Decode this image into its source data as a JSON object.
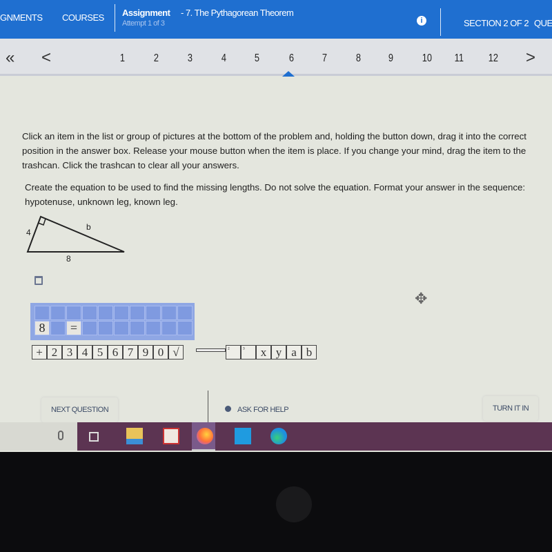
{
  "header": {
    "nav_assignments": "GNMENTS",
    "nav_courses": "COURSES",
    "assignment_label": "Assignment",
    "assignment_title": "- 7. The Pythagorean Theorem",
    "attempt": "Attempt 1 of 3",
    "info_icon": "info-icon",
    "section": "SECTION 2 OF 2",
    "questions_cut": "QUES",
    "color": "#1f6fd0"
  },
  "pager": {
    "first": "«",
    "prev": "<",
    "next": ">",
    "pages": [
      "1",
      "2",
      "3",
      "4",
      "5",
      "6",
      "7",
      "8",
      "9",
      "10",
      "11",
      "12"
    ],
    "current": "6"
  },
  "instructions": {
    "drag": "Click an item in the list or group of pictures at the bottom of the problem and, holding the button down, drag it into the correct position in the answer box. Release your mouse button when the item is place. If you change your mind, drag the item to the trashcan. Click the trashcan to clear all your answers.",
    "question": "Create the equation to be used to find the missing lengths. Do not solve the equation. Format your answer in the sequence: hypotenuse, unknown leg, known leg."
  },
  "figure": {
    "leg_label": "4",
    "hyp_label": "b",
    "base_label": "8"
  },
  "answer_box": {
    "cells": [
      "8",
      "",
      "="
    ]
  },
  "tiles": [
    "+",
    "2",
    "3",
    "4",
    "5",
    "6",
    "7",
    "9",
    "0",
    "√",
    "",
    "²",
    "³",
    "x",
    "y",
    "a",
    "b"
  ],
  "footer": {
    "next": "NEXT QUESTION",
    "help": "ASK FOR HELP",
    "turn_in": "TURN IT IN"
  },
  "taskbar": {
    "icons": [
      "microphone-icon",
      "task-view-icon",
      "file-explorer-icon",
      "app-icon",
      "firefox-icon",
      "mail-icon",
      "edge-icon"
    ]
  }
}
